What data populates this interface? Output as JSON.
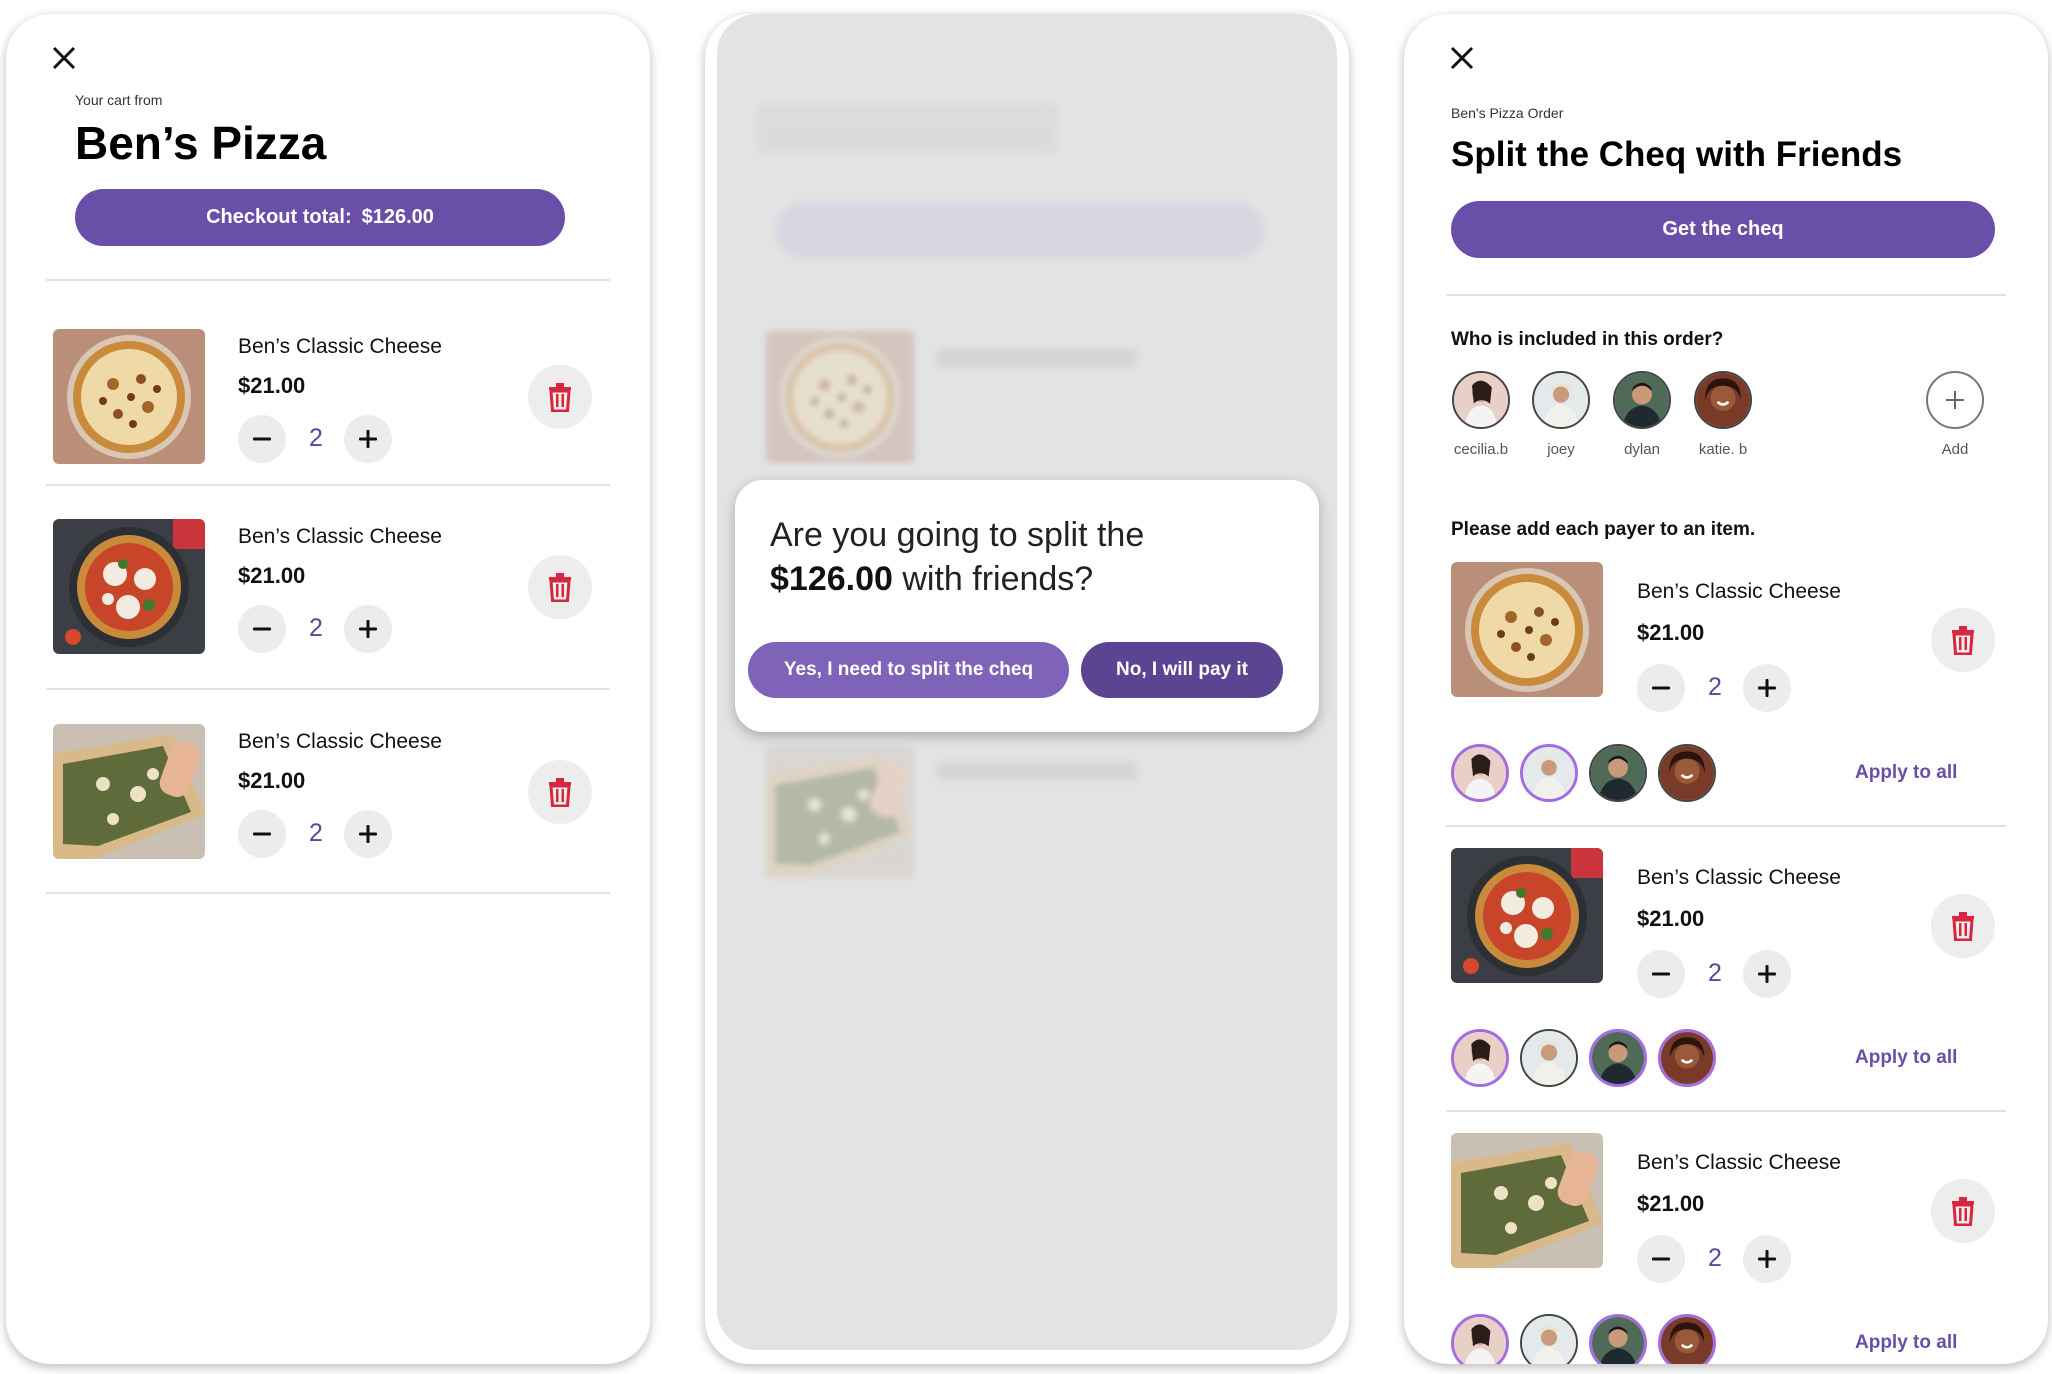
{
  "cart": {
    "subtitle": "Your cart from",
    "restaurant": "Ben’s Pizza",
    "checkout_label": "Checkout total:",
    "checkout_amount": "$126.00",
    "items": [
      {
        "name": "Ben’s Classic Cheese",
        "price": "$21.00",
        "quantity": "2",
        "image": "cheese-pizza-photo"
      },
      {
        "name": "Ben’s Classic Cheese",
        "price": "$21.00",
        "quantity": "2",
        "image": "margherita-pizza-photo"
      },
      {
        "name": "Ben’s Classic Cheese",
        "price": "$21.00",
        "quantity": "2",
        "image": "spinach-pizza-photo"
      }
    ]
  },
  "dialog": {
    "question_line1": "Are you going to split the",
    "question_amount": "$126.00",
    "question_line2_rest": " with friends?",
    "yes_label": "Yes, I need to split the cheq",
    "no_label": "No, I will pay it"
  },
  "split": {
    "subtitle": "Ben's Pizza Order",
    "title": "Split the Cheq with Friends",
    "get_cheq_label": "Get the cheq",
    "who_label": "Who is included in this order?",
    "friends": [
      {
        "name": "cecilia.b"
      },
      {
        "name": "joey"
      },
      {
        "name": "dylan"
      },
      {
        "name": "katie. b"
      }
    ],
    "add_label": "Add",
    "payer_instruction": "Please add each payer to an item.",
    "apply_all_label": "Apply to all",
    "items": [
      {
        "name": "Ben’s Classic Cheese",
        "price": "$21.00",
        "quantity": "2"
      },
      {
        "name": "Ben’s Classic Cheese",
        "price": "$21.00",
        "quantity": "2"
      },
      {
        "name": "Ben’s Classic Cheese",
        "price": "$21.00",
        "quantity": "2"
      }
    ]
  },
  "colors": {
    "accent": "#6a4fa8",
    "accent_light": "#7e63b8",
    "accent_dark": "#5b4593",
    "delete_red": "#d7263d",
    "selected_ring": "#a36de0"
  }
}
